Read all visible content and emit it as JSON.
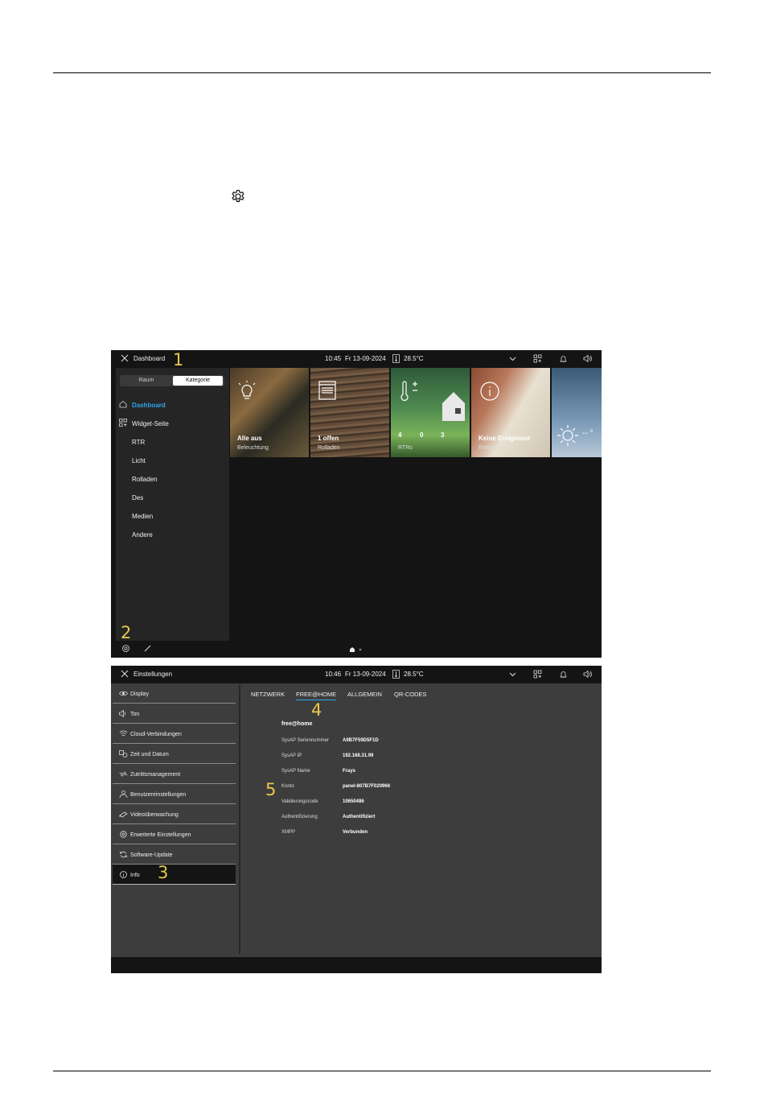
{
  "doc_icon": "gear-icon",
  "screen1": {
    "topbar": {
      "title": "Dashboard",
      "time": "10:45",
      "date": "Fr 13-09-2024",
      "temperature": "28.5°C"
    },
    "markers": [
      "1",
      "2"
    ],
    "segment": {
      "options": [
        "Raum",
        "Kategorie"
      ],
      "selected": "Kategorie"
    },
    "nav": [
      {
        "label": "Dashboard",
        "icon": "home-icon",
        "active": true
      },
      {
        "label": "Widget-Seite",
        "icon": "widget-grid-icon"
      },
      {
        "label": "RTR"
      },
      {
        "label": "Licht"
      },
      {
        "label": "Rolladen"
      },
      {
        "label": "Des"
      },
      {
        "label": "Medien"
      },
      {
        "label": "Andere"
      }
    ],
    "tiles": [
      {
        "title": "Alle aus",
        "subtitle": "Beleuchtung",
        "icon": "lightbulb-icon"
      },
      {
        "title": "1 offen",
        "subtitle": "Rolladen",
        "icon": "blind-icon"
      },
      {
        "title": "",
        "subtitle": "RTRs",
        "icon": "thermometer-icon",
        "counts": [
          "4",
          "0",
          "3"
        ]
      },
      {
        "title": "Keine Ereignisse",
        "subtitle": "Ereignisse",
        "icon": "info-icon"
      },
      {
        "title": "",
        "subtitle": "",
        "icon": "sun-icon",
        "value": "-- °"
      }
    ],
    "page_indicator": {
      "pages": 2,
      "current": 1
    }
  },
  "screen2": {
    "topbar": {
      "title": "Einstellungen",
      "time": "10:46",
      "date": "Fr 13-09-2024",
      "temperature": "28.5°C"
    },
    "markers": [
      "3",
      "4",
      "5"
    ],
    "menu": [
      {
        "label": "Display",
        "icon": "eye-icon"
      },
      {
        "label": "Ton",
        "icon": "speaker-icon"
      },
      {
        "label": "Cloud-Verbindungen",
        "icon": "wifi-icon"
      },
      {
        "label": "Zeit und Datum",
        "icon": "clock-icon"
      },
      {
        "label": "Zutrittsmanagement",
        "icon": "key-icon"
      },
      {
        "label": "Benutzereinstellungen",
        "icon": "user-icon"
      },
      {
        "label": "Videoüberwachung",
        "icon": "camera-icon"
      },
      {
        "label": "Erweiterte Einstellungen",
        "icon": "gear-icon"
      },
      {
        "label": "Software-Update",
        "icon": "refresh-icon"
      },
      {
        "label": "Info",
        "icon": "info-icon",
        "selected": true
      }
    ],
    "tabs": [
      "NETZWERK",
      "FREE@HOME",
      "ALLGEMEIN",
      "QR-CODES"
    ],
    "active_tab": "FREE@HOME",
    "info_heading": "free@home",
    "info_rows": [
      {
        "key": "SysAP Seriennummer",
        "value": "A9B7F59D5F1D"
      },
      {
        "key": "SysAP IP",
        "value": "192.168.31.99"
      },
      {
        "key": "SysAP Name",
        "value": "Frays"
      },
      {
        "key": "Konto",
        "value": "panel-807B7F020966"
      },
      {
        "key": "Validierungscode",
        "value": "10650486"
      },
      {
        "key": "Authentifizierung",
        "value": "Authentifiziert"
      },
      {
        "key": "XMPP",
        "value": "Verbunden"
      }
    ]
  },
  "colors": {
    "accent_blue": "#2fa4e8",
    "marker_yellow": "#e8c84a"
  }
}
